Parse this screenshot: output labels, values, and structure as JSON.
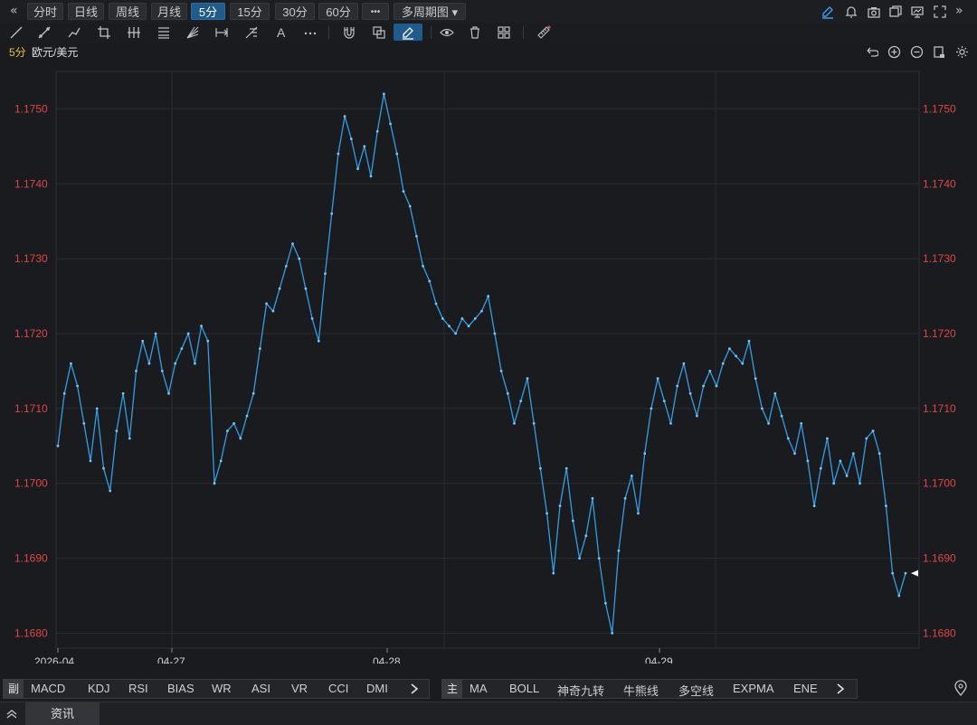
{
  "toolbar": {
    "periods": [
      "分时",
      "日线",
      "周线",
      "月线",
      "5分",
      "15分",
      "30分",
      "60分"
    ],
    "active_period": "5分",
    "more_label": "•••",
    "multi_period_label": "多周期图 ▾"
  },
  "symbol": {
    "period": "5分",
    "name": "欧元/美元"
  },
  "indicators_left": {
    "lead": "副",
    "items": [
      "MACD",
      "KDJ",
      "RSI",
      "BIAS",
      "WR",
      "ASI",
      "VR",
      "CCI",
      "DMI"
    ]
  },
  "indicators_right": {
    "lead": "主",
    "items": [
      "MA",
      "BOLL",
      "神奇九转",
      "牛熊线",
      "多空线",
      "EXPMA",
      "ENE"
    ]
  },
  "news": {
    "tab_label": "资讯"
  },
  "colors": {
    "line": "#2f9fe6",
    "axis_label": "#e04646",
    "grid": "#2b2c30",
    "background": "#1a1b1e"
  },
  "chart_data": {
    "type": "line",
    "y_ticks": [
      "1.1680",
      "1.1690",
      "1.1700",
      "1.1710",
      "1.1720",
      "1.1730",
      "1.1740",
      "1.1750"
    ],
    "ylim": [
      1.1678,
      1.1755
    ],
    "x_ticks": [
      "2026-04",
      "04-27",
      "04-28",
      "04-29"
    ],
    "last_value": 1.1688,
    "series": [
      {
        "values": [
          1.1705,
          1.1712,
          1.1716,
          1.1713,
          1.1708,
          1.1703,
          1.171,
          1.1702,
          1.1699,
          1.1707,
          1.1712,
          1.1706,
          1.1715,
          1.1719,
          1.1716,
          1.172,
          1.1715,
          1.1712,
          1.1716,
          1.1718,
          1.172,
          1.1716,
          1.1721,
          1.1719,
          1.17,
          1.1703,
          1.1707,
          1.1708,
          1.1706,
          1.1709,
          1.1712,
          1.1718,
          1.1724,
          1.1723,
          1.1726,
          1.1729,
          1.1732,
          1.173,
          1.1726,
          1.1722,
          1.1719,
          1.1728,
          1.1736,
          1.1744,
          1.1749,
          1.1746,
          1.1742,
          1.1745,
          1.1741,
          1.1747,
          1.1752,
          1.1748,
          1.1744,
          1.1739,
          1.1737,
          1.1733,
          1.1729,
          1.1727,
          1.1724,
          1.1722,
          1.1721,
          1.172,
          1.1722,
          1.1721,
          1.1722,
          1.1723,
          1.1725,
          1.172,
          1.1715,
          1.1712,
          1.1708,
          1.1711,
          1.1714,
          1.1708,
          1.1702,
          1.1696,
          1.1688,
          1.1697,
          1.1702,
          1.1695,
          1.169,
          1.1693,
          1.1698,
          1.169,
          1.1684,
          1.168,
          1.1691,
          1.1698,
          1.1701,
          1.1696,
          1.1704,
          1.171,
          1.1714,
          1.1711,
          1.1708,
          1.1713,
          1.1716,
          1.1712,
          1.1709,
          1.1713,
          1.1715,
          1.1713,
          1.1716,
          1.1718,
          1.1717,
          1.1716,
          1.1719,
          1.1714,
          1.171,
          1.1708,
          1.1712,
          1.1709,
          1.1706,
          1.1704,
          1.1708,
          1.1703,
          1.1697,
          1.1702,
          1.1706,
          1.17,
          1.1703,
          1.1701,
          1.1704,
          1.17,
          1.1706,
          1.1707,
          1.1704,
          1.1697,
          1.1688,
          1.1685,
          1.1688
        ]
      }
    ]
  }
}
